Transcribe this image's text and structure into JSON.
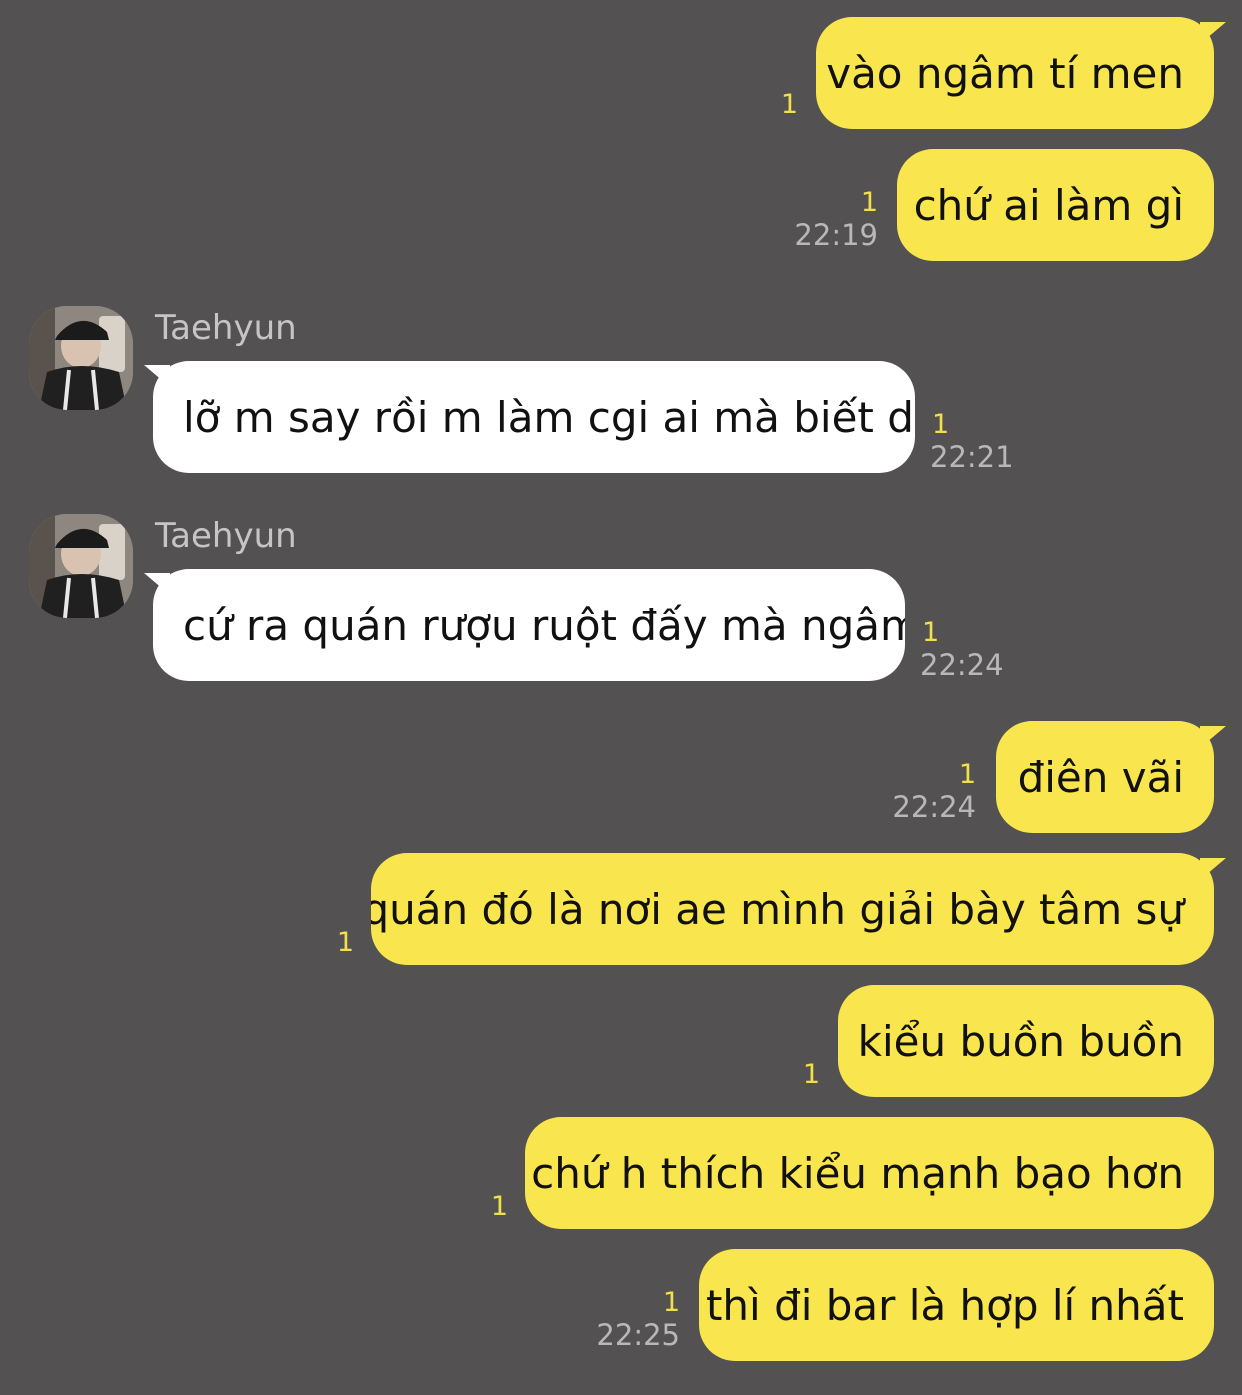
{
  "sender_name": "Taehyun",
  "messages": [
    {
      "text": "vào ngâm tí men",
      "unread": "1",
      "time": ""
    },
    {
      "text": "chứ ai làm gì",
      "unread": "1",
      "time": "22:19"
    },
    {
      "text": "lỡ m say rồi m làm cgi ai mà biết dc",
      "unread": "1",
      "time": "22:21"
    },
    {
      "text": "cứ ra quán rượu ruột đấy mà ngâm",
      "unread": "1",
      "time": "22:24"
    },
    {
      "text": "điên vãi",
      "unread": "1",
      "time": "22:24"
    },
    {
      "text": "quán đó là nơi ae mình giải bày tâm sự",
      "unread": "1",
      "time": ""
    },
    {
      "text": "kiểu buồn buồn",
      "unread": "1",
      "time": ""
    },
    {
      "text": "chứ h thích kiểu mạnh bạo hơn",
      "unread": "1",
      "time": ""
    },
    {
      "text": "thì đi bar là hợp lí nhất",
      "unread": "1",
      "time": "22:25"
    }
  ],
  "colors": {
    "background": "#535151",
    "outgoing_bubble": "#f9e54d",
    "incoming_bubble": "#ffffff",
    "unread_count": "#f2e04a",
    "timestamp": "#b9b7b7"
  }
}
